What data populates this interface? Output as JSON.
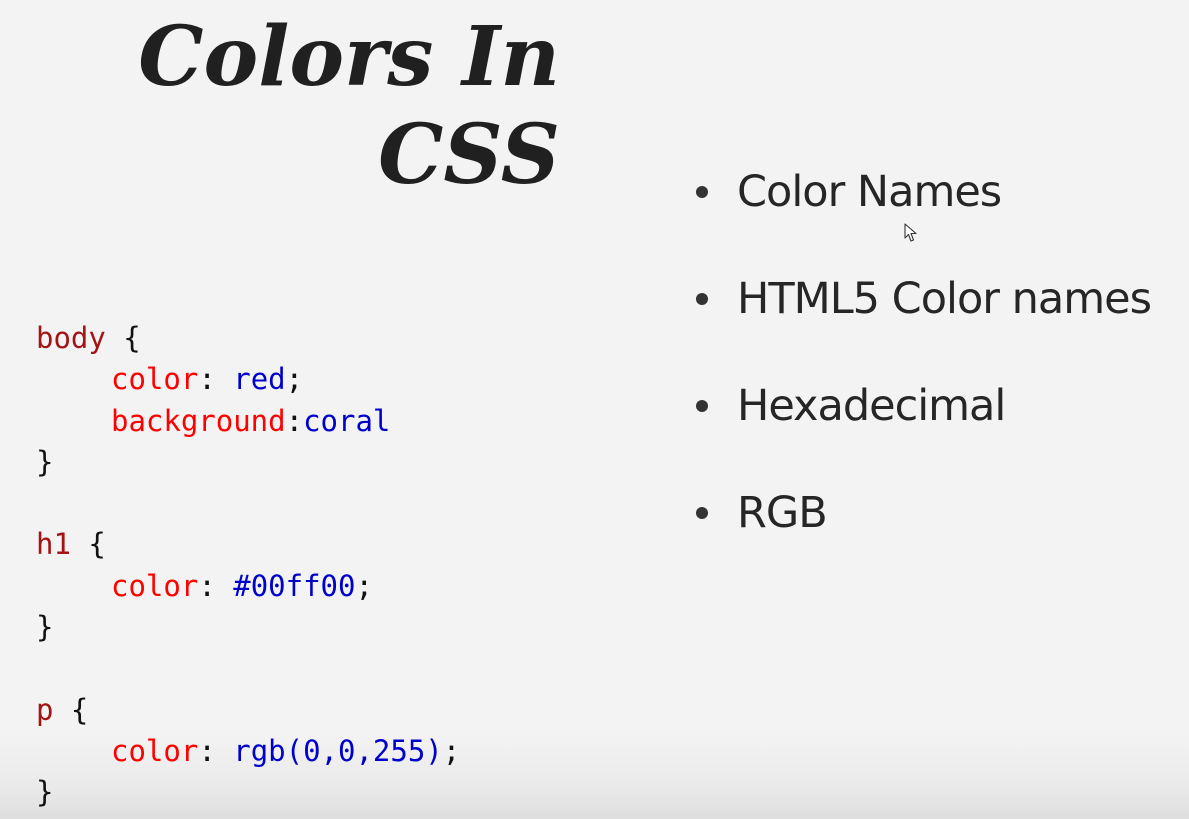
{
  "slide": {
    "title_line1": "Colors In",
    "title_line2": "CSS"
  },
  "code": {
    "body_selector": "body",
    "body_color_prop": "color",
    "body_color_val": "red",
    "body_bg_prop": "background",
    "body_bg_val": "coral",
    "h1_selector": "h1",
    "h1_color_prop": "color",
    "h1_color_val": "#00ff00",
    "p_selector": "p",
    "p_color_prop": "color",
    "p_color_val": "rgb(0,0,255)",
    "open_brace": " {",
    "close_brace": "}",
    "colon": ":",
    "colon_space": ": ",
    "semicolon": ";"
  },
  "bullets": [
    {
      "label": "Color Names"
    },
    {
      "label": "HTML5 Color names"
    },
    {
      "label": "Hexadecimal"
    },
    {
      "label": "RGB"
    }
  ],
  "colors": {
    "selector": "#a31515",
    "property": "#ff0000",
    "value": "#0000cd",
    "background": "#f3f3f3",
    "text": "#262626"
  },
  "icons": {
    "cursor": "mouse-pointer-icon"
  }
}
